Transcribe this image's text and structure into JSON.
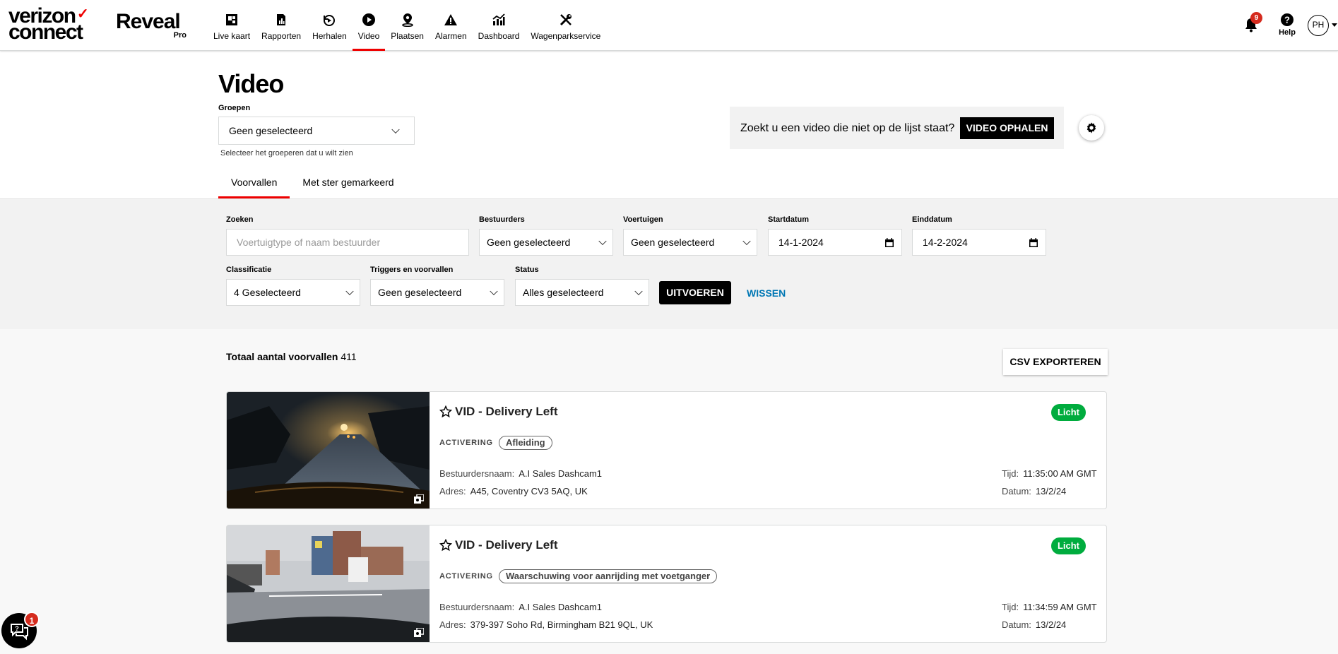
{
  "brand": {
    "logo_line1": "verizon",
    "logo_line2": "connect",
    "product": "Reveal",
    "tier": "Pro"
  },
  "nav": [
    {
      "id": "live",
      "label": "Live kaart",
      "icon": "map-marker-icon",
      "active": false
    },
    {
      "id": "reports",
      "label": "Rapporten",
      "icon": "report-icon",
      "active": false
    },
    {
      "id": "replay",
      "label": "Herhalen",
      "icon": "replay-icon",
      "active": false
    },
    {
      "id": "video",
      "label": "Video",
      "icon": "play-icon",
      "active": true
    },
    {
      "id": "places",
      "label": "Plaatsen",
      "icon": "place-pin-icon",
      "active": false
    },
    {
      "id": "alarms",
      "label": "Alarmen",
      "icon": "warning-icon",
      "active": false
    },
    {
      "id": "dashboard",
      "label": "Dashboard",
      "icon": "chart-icon",
      "active": false
    },
    {
      "id": "fleet",
      "label": "Wagenparkservice",
      "icon": "tools-icon",
      "active": false
    }
  ],
  "header": {
    "notifications": "9",
    "help_label": "Help",
    "user_initials": "PH"
  },
  "page": {
    "title": "Video",
    "groups_label": "Groepen",
    "groups_value": "Geen geselecteerd",
    "groups_help": "Selecteer het groeperen dat u wilt zien",
    "promo_text": "Zoekt u een video die niet op de lijst staat?",
    "promo_button": "VIDEO OPHALEN"
  },
  "tabs": [
    {
      "label": "Voorvallen",
      "active": true
    },
    {
      "label": "Met ster gemarkeerd",
      "active": false
    }
  ],
  "filters": {
    "search_label": "Zoeken",
    "search_placeholder": "Voertuigtype of naam bestuurder",
    "drivers_label": "Bestuurders",
    "drivers_value": "Geen geselecteerd",
    "vehicles_label": "Voertuigen",
    "vehicles_value": "Geen geselecteerd",
    "start_label": "Startdatum",
    "start_value": "14-1-2024",
    "end_label": "Einddatum",
    "end_value": "14-2-2024",
    "class_label": "Classificatie",
    "class_value": "4 Geselecteerd",
    "triggers_label": "Triggers en voorvallen",
    "triggers_value": "Geen geselecteerd",
    "status_label": "Status",
    "status_value": "Alles geselecteerd",
    "run_button": "UITVOEREN",
    "clear_link": "WISSEN"
  },
  "list": {
    "total_label": "Totaal aantal voorvallen",
    "total_value": "411",
    "export_button": "CSV EXPORTEREN",
    "activation_label": "ACTIVERING",
    "driver_key": "Bestuurdersnaam:",
    "address_key": "Adres:",
    "time_key": "Tijd:",
    "date_key": "Datum:",
    "events": [
      {
        "title": "VID - Delivery Left",
        "severity": "Licht",
        "trigger": "Afleiding",
        "driver": "A.I Sales Dashcam1",
        "address": "A45, Coventry CV3 5AQ, UK",
        "time": "11:35:00 AM GMT",
        "date": "13/2/24"
      },
      {
        "title": "VID - Delivery Left",
        "severity": "Licht",
        "trigger": "Waarschuwing voor aanrijding met voetganger",
        "driver": "A.I Sales Dashcam1",
        "address": "379-397 Soho Rd, Birmingham B21 9QL, UK",
        "time": "11:34:59 AM GMT",
        "date": "13/2/24"
      }
    ]
  },
  "chat": {
    "badge": "1"
  },
  "colors": {
    "accent": "#ee0000",
    "severity_green": "#00ac3e",
    "link_blue": "#0077b4"
  }
}
